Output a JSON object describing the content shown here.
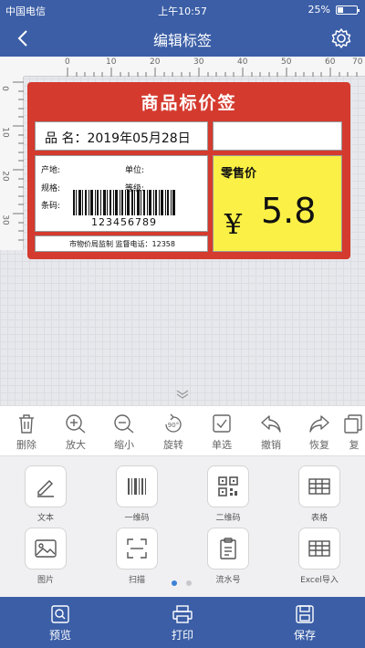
{
  "status_bar": {
    "carrier": "中国电信",
    "time": "上午10:57",
    "battery": "25%"
  },
  "nav": {
    "title": "编辑标签",
    "back_icon": "chevron-left-icon",
    "settings_icon": "gear-icon"
  },
  "ruler": {
    "top_ticks": [
      "0",
      "10",
      "20",
      "30",
      "40",
      "50",
      "60",
      "70"
    ],
    "left_ticks": [
      "0",
      "10",
      "20",
      "30"
    ]
  },
  "label": {
    "title": "商品标价签",
    "product_name": "品 名：2019年05月28日",
    "origin_label": "产地:",
    "unit_label": "单位:",
    "spec_label": "规格:",
    "grade_label": "等级:",
    "barcode_label": "条码:",
    "barcode_number": "123456789",
    "footer": "市物价局监制   监督电话：12358",
    "price_label": "零售价",
    "currency_symbol": "¥",
    "price": "5.8",
    "colors": {
      "header": "#d43a2e",
      "price_bg": "#fbf046"
    }
  },
  "toolbar": {
    "items": [
      {
        "label": "删除",
        "icon": "trash-icon"
      },
      {
        "label": "放大",
        "icon": "zoom-in-icon"
      },
      {
        "label": "缩小",
        "icon": "zoom-out-icon"
      },
      {
        "label": "旋转",
        "icon": "rotate-90-icon",
        "icon_text": "90°"
      },
      {
        "label": "单选",
        "icon": "checkbox-icon"
      },
      {
        "label": "撤销",
        "icon": "undo-icon"
      },
      {
        "label": "恢复",
        "icon": "redo-icon"
      },
      {
        "label": "复",
        "icon": "copy-icon"
      }
    ]
  },
  "palette": {
    "items": [
      {
        "label": "文本",
        "icon": "pen-icon"
      },
      {
        "label": "一维码",
        "icon": "barcode-icon"
      },
      {
        "label": "二维码",
        "icon": "qrcode-icon"
      },
      {
        "label": "表格",
        "icon": "table-icon"
      },
      {
        "label": "图片",
        "icon": "image-icon"
      },
      {
        "label": "扫描",
        "icon": "scan-icon"
      },
      {
        "label": "流水号",
        "icon": "clipboard-icon"
      },
      {
        "label": "Excel导入",
        "icon": "excel-table-icon"
      }
    ],
    "page_indicator": {
      "current": 1,
      "total": 2
    }
  },
  "bottom": {
    "preview": "预览",
    "print": "打印",
    "save": "保存"
  },
  "theme": {
    "primary": "#3b5ea6",
    "accent_dot": "#3b82d6"
  }
}
